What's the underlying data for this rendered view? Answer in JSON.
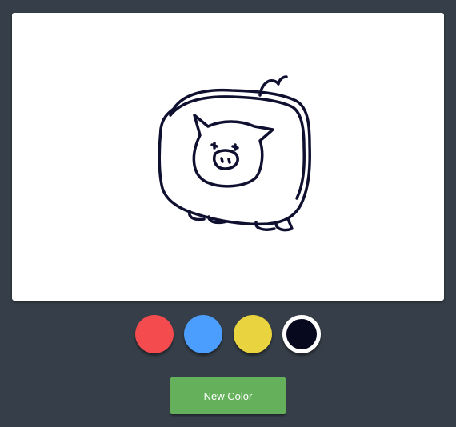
{
  "canvas": {
    "drawing_icon": "pig-drawing-icon",
    "stroke_color": "#0f1030"
  },
  "palette": {
    "colors": [
      {
        "name": "red",
        "hex": "#f44b4f",
        "selected": false
      },
      {
        "name": "blue",
        "hex": "#4c9efe",
        "selected": false
      },
      {
        "name": "yellow",
        "hex": "#e9d33f",
        "selected": false
      },
      {
        "name": "navy",
        "hex": "#07091f",
        "selected": true
      }
    ]
  },
  "actions": {
    "new_color_label": "New Color",
    "new_color_bg": "#65b15b"
  }
}
